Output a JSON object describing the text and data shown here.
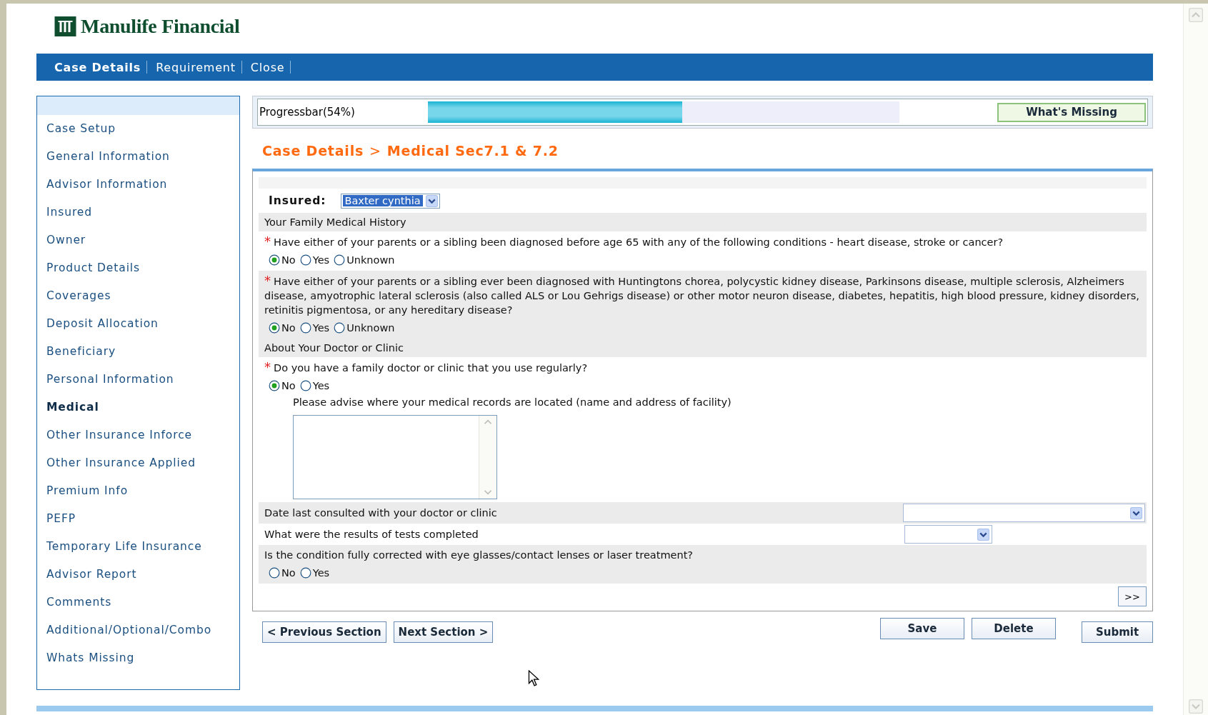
{
  "logo": {
    "text": "Manulife Financial"
  },
  "nav": [
    {
      "label": "Case Details",
      "selected": true
    },
    {
      "label": "Requirement",
      "selected": false
    },
    {
      "label": "Close",
      "selected": false
    }
  ],
  "sidebar": {
    "items": [
      {
        "label": "Case Setup",
        "selected": false
      },
      {
        "label": "General Information",
        "selected": false
      },
      {
        "label": "Advisor Information",
        "selected": false
      },
      {
        "label": "Insured",
        "selected": false
      },
      {
        "label": "Owner",
        "selected": false
      },
      {
        "label": "Product Details",
        "selected": false
      },
      {
        "label": "Coverages",
        "selected": false
      },
      {
        "label": "Deposit Allocation",
        "selected": false
      },
      {
        "label": "Beneficiary",
        "selected": false
      },
      {
        "label": "Personal Information",
        "selected": false
      },
      {
        "label": "Medical",
        "selected": true
      },
      {
        "label": "Other Insurance Inforce",
        "selected": false
      },
      {
        "label": "Other Insurance Applied",
        "selected": false
      },
      {
        "label": "Premium Info",
        "selected": false
      },
      {
        "label": "PEFP",
        "selected": false
      },
      {
        "label": "Temporary Life Insurance",
        "selected": false
      },
      {
        "label": "Advisor Report",
        "selected": false
      },
      {
        "label": "Comments",
        "selected": false
      },
      {
        "label": "Additional/Optional/Combo",
        "selected": false
      },
      {
        "label": "Whats Missing",
        "selected": false
      }
    ]
  },
  "progress": {
    "label": "Progressbar(54%)",
    "level": 0.54,
    "button": "What's Missing"
  },
  "breadcrumb": {
    "section": "Case Details",
    "separator": ">",
    "page": "Medical Sec7.1 & 7.2"
  },
  "form": {
    "insured": {
      "label": "Insured:",
      "value": "Baxter cynthia"
    },
    "rows": [
      {
        "kind": "heading",
        "text": "Your Family Medical History"
      },
      {
        "kind": "question",
        "shaded": false,
        "required_mark": "*",
        "text": "Have either of your parents or a sibling been diagnosed before age 65 with any of the following conditions - heart disease, stroke or cancer?",
        "options": [
          {
            "label": "No",
            "selected": true
          },
          {
            "label": "Yes",
            "selected": false
          },
          {
            "label": "Unknown",
            "selected": false
          }
        ]
      },
      {
        "kind": "question",
        "shaded": true,
        "required_mark": "*",
        "text": "Have either of your parents or a sibling ever been diagnosed with Huntingtons chorea, polycystic kidney disease, Parkinsons disease, multiple sclerosis, Alzheimers disease, amyotrophic lateral sclerosis (also called ALS or Lou Gehrigs disease) or other motor neuron disease, diabetes, hepatitis, high blood pressure, kidney disorders, retinitis pigmentosa, or any hereditary disease?",
        "options": [
          {
            "label": "No",
            "selected": true
          },
          {
            "label": "Yes",
            "selected": false
          },
          {
            "label": "Unknown",
            "selected": false
          }
        ]
      },
      {
        "kind": "heading",
        "text": "About Your Doctor or Clinic"
      },
      {
        "kind": "question",
        "shaded": false,
        "required_mark": "*",
        "text": "Do you have a family doctor or clinic that you use regularly?",
        "options": [
          {
            "label": "No",
            "selected": true
          },
          {
            "label": "Yes",
            "selected": false
          }
        ]
      },
      {
        "kind": "textarea",
        "text": "Please advise where your medical records are located (name and address of facility)"
      },
      {
        "kind": "select",
        "shaded": true,
        "text": "Date last consulted with your doctor or clinic"
      },
      {
        "kind": "select",
        "shaded": false,
        "text": "What were the results of tests completed"
      },
      {
        "kind": "question",
        "shaded": true,
        "text": "Is the condition fully corrected with eye glasses/contact lenses or laser treatment?",
        "options": [
          {
            "label": "No",
            "selected": false
          },
          {
            "label": "Yes",
            "selected": false
          }
        ]
      }
    ],
    "more_button": ">>"
  },
  "nav_buttons": [
    "< Previous Section",
    "Next Section >"
  ],
  "action_buttons": [
    {
      "label": "Save",
      "kind": "raised"
    },
    {
      "label": "Delete",
      "kind": "raised"
    },
    {
      "label": "Submit",
      "kind": "low"
    }
  ]
}
